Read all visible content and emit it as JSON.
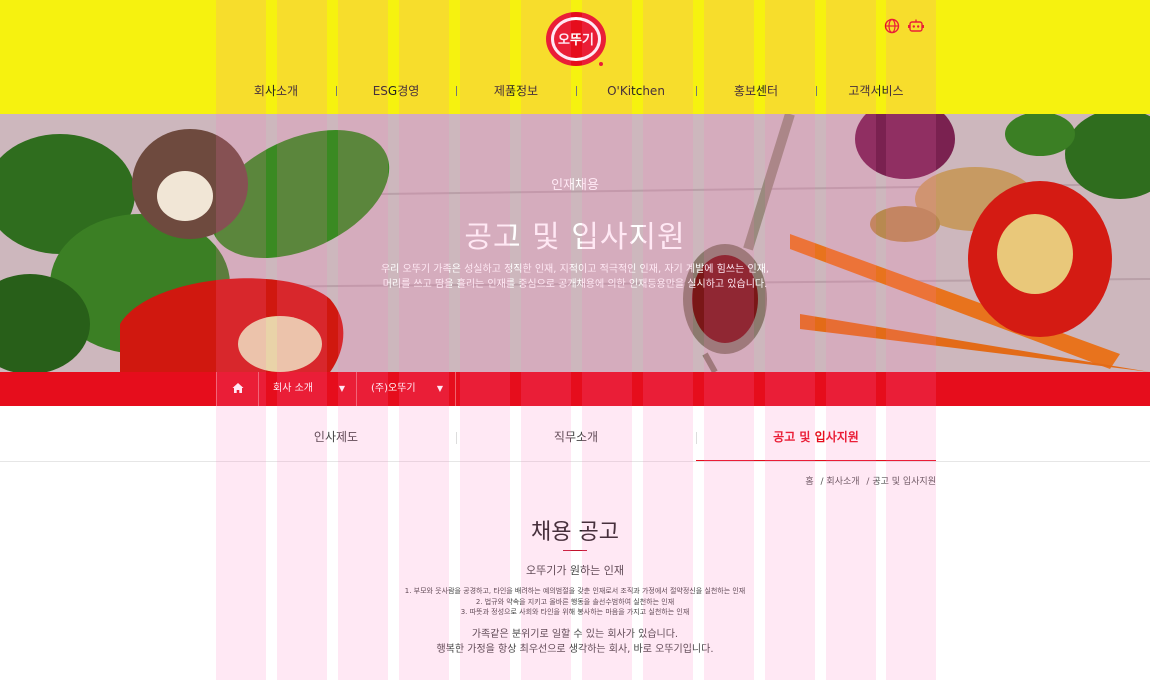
{
  "header": {
    "logo_text": "오뚜기",
    "nav": [
      "회사소개",
      "ESG경영",
      "제품정보",
      "O'Kitchen",
      "홍보센터",
      "고객서비스"
    ],
    "icons": [
      "globe-icon",
      "robot-icon"
    ]
  },
  "hero": {
    "subtitle": "인재채용",
    "title": "공고 및 입사지원",
    "desc_line1": "우리 오뚜기 가족은 성실하고 정직한 인재, 지적이고 적극적인 인재, 자기 계발에 힘쓰는 인재,",
    "desc_line2": "머리를 쓰고 땀을 흘리는 인재를 중심으로 공개채용에 의한 인재등용만을 실시하고 있습니다."
  },
  "location": {
    "home_icon": "home-icon",
    "select1": "회사 소개",
    "select2": "(주)오뚜기"
  },
  "tabs": [
    {
      "label": "인사제도"
    },
    {
      "label": "직무소개"
    },
    {
      "label": "공고 및 입사지원"
    }
  ],
  "breadcrumb": [
    "홈",
    "/ 회사소개",
    "/ 공고 및 입사지원"
  ],
  "section": {
    "title": "채용 공고",
    "subtitle": "오뚜기가 원하는 인재",
    "items": [
      "1. 부모와 웃사람을 공경하고, 타인을 배려하는 예의범절을 갖춘 인재로서 조직과 가정에서 절약정신을 실천하는 인재",
      "2. 법규와 약속을 지키고 올바른 행동을 솔선수범하여 실천하는 인재",
      "3. 따뜻과 정성으로 사회와 타인을 위해 봉사하는 마음을 가지고 실천하는 인재"
    ],
    "closing1": "가족같은 분위기로 일할 수 있는 회사가 있습니다.",
    "closing2": "행복한 가정을 항상 최우선으로 생각하는 회사, 바로 오뚜기입니다."
  },
  "colors": {
    "header_bg": "#f6f20f",
    "brand_red": "#e60d1c"
  }
}
